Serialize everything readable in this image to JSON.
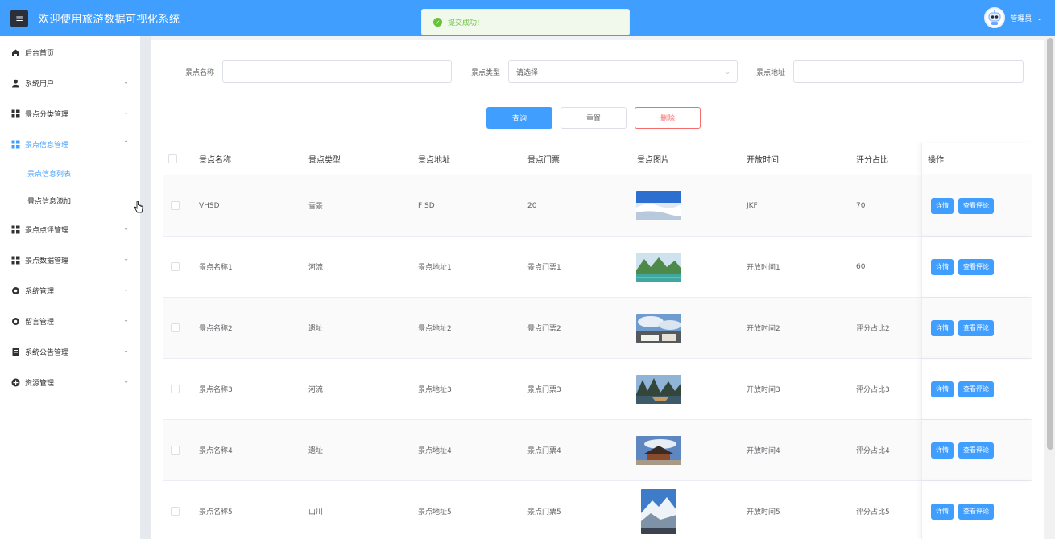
{
  "header": {
    "menu_icon": "hamburger-icon",
    "title": "欢迎使用旅游数据可视化系统",
    "user": "管理员",
    "avatar_icon": "robot-avatar"
  },
  "toast": {
    "icon": "check-circle-icon",
    "text": "提交成功!"
  },
  "sidebar": {
    "items": [
      {
        "label": "后台首页",
        "icon": "home-icon",
        "expandable": false
      },
      {
        "label": "系统用户",
        "icon": "user-icon",
        "expandable": true
      },
      {
        "label": "景点分类管理",
        "icon": "grid-icon",
        "expandable": true
      },
      {
        "label": "景点信息管理",
        "icon": "grid-icon",
        "expandable": true,
        "open": true
      },
      {
        "label": "景点点评管理",
        "icon": "grid-icon",
        "expandable": true
      },
      {
        "label": "景点数据管理",
        "icon": "grid-icon",
        "expandable": true
      },
      {
        "label": "系统管理",
        "icon": "gear-icon",
        "expandable": true
      },
      {
        "label": "留言管理",
        "icon": "gear-icon",
        "expandable": true
      },
      {
        "label": "系统公告管理",
        "icon": "document-icon",
        "expandable": true
      },
      {
        "label": "资源管理",
        "icon": "plus-circle-icon",
        "expandable": true
      }
    ],
    "subitems": [
      {
        "label": "景点信息列表",
        "active": true
      },
      {
        "label": "景点信息添加",
        "active": false
      }
    ]
  },
  "search": {
    "name_label": "景点名称",
    "type_label": "景点类型",
    "type_placeholder": "请选择",
    "address_label": "景点地址",
    "query_btn": "查询",
    "reset_btn": "重置",
    "delete_btn": "删除"
  },
  "table": {
    "headers": [
      "景点名称",
      "景点类型",
      "景点地址",
      "景点门票",
      "景点图片",
      "开放时间",
      "评分占比",
      "操作"
    ],
    "detail_btn": "详情",
    "review_btn": "查看评论",
    "rows": [
      {
        "name": "VHSD",
        "type": "雪景",
        "address": "F SD",
        "ticket": "20",
        "image": "snow-mountain",
        "open_time": "JKF",
        "score": "70"
      },
      {
        "name": "景点名称1",
        "type": "河流",
        "address": "景点地址1",
        "ticket": "景点门票1",
        "image": "river-karst",
        "open_time": "开放时间1",
        "score": "60"
      },
      {
        "name": "景点名称2",
        "type": "遗址",
        "address": "景点地址2",
        "ticket": "景点门票2",
        "image": "old-town-sky",
        "open_time": "开放时间2",
        "score": "评分占比2"
      },
      {
        "name": "景点名称3",
        "type": "河流",
        "address": "景点地址3",
        "ticket": "景点门票3",
        "image": "river-karst-boat",
        "open_time": "开放时间3",
        "score": "评分占比3"
      },
      {
        "name": "景点名称4",
        "type": "遗址",
        "address": "景点地址4",
        "ticket": "景点门票4",
        "image": "temple-ruins",
        "open_time": "开放时间4",
        "score": "评分占比4"
      },
      {
        "name": "景点名称5",
        "type": "山川",
        "address": "景点地址5",
        "ticket": "景点门票5",
        "image": "snow-peak",
        "open_time": "开放时间5",
        "score": "评分占比5"
      }
    ]
  },
  "colors": {
    "primary": "#409eff",
    "danger": "#f56c6c",
    "success": "#67c23a"
  }
}
